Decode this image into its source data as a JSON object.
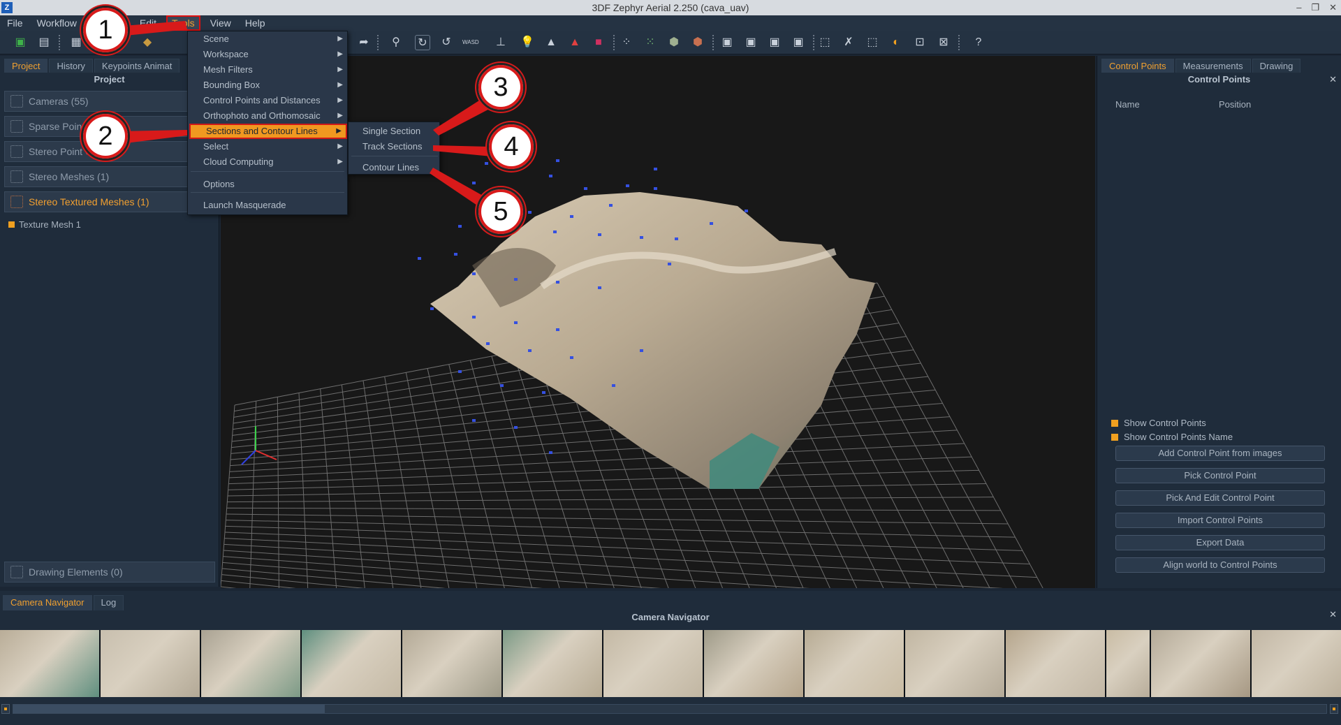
{
  "window": {
    "title": "3DF Zephyr Aerial 2.250 (cava_uav)",
    "icon": "Z",
    "controls": [
      "–",
      "❐",
      "✕"
    ]
  },
  "menubar": [
    "File",
    "Workflow",
    "Edit",
    "Tools",
    "View",
    "Help"
  ],
  "toolbar": {
    "help_label": "?"
  },
  "left_panel": {
    "tabs": [
      "Project",
      "History",
      "Keypoints Animat"
    ],
    "title": "Project",
    "items": [
      "Cameras (55)",
      "Sparse Point",
      "Stereo Point Cl (1)",
      "Stereo Meshes (1)",
      "Stereo Textured Meshes (1)"
    ],
    "tree_item": "Texture Mesh 1",
    "drawing_elements": "Drawing Elements (0)"
  },
  "tools_menu": {
    "items": [
      {
        "label": "Scene",
        "submenu": true
      },
      {
        "label": "Workspace",
        "submenu": true
      },
      {
        "label": "Mesh Filters",
        "submenu": true
      },
      {
        "label": "Bounding Box",
        "submenu": true
      },
      {
        "label": "Control Points and Distances",
        "submenu": true
      },
      {
        "label": "Orthophoto and Orthomosaic",
        "submenu": true
      },
      {
        "label": "Sections and Contour Lines",
        "submenu": true,
        "highlighted": true
      },
      {
        "label": "Select",
        "submenu": true
      },
      {
        "label": "Cloud Computing",
        "submenu": true
      },
      {
        "label": "Options",
        "submenu": false
      },
      {
        "label": "Launch Masquerade",
        "submenu": false
      }
    ]
  },
  "sections_submenu": {
    "items": [
      "Single Section",
      "Track Sections",
      "Contour Lines"
    ]
  },
  "callouts": [
    "1",
    "2",
    "3",
    "4",
    "5"
  ],
  "right_panel": {
    "tabs": [
      "Control Points",
      "Measurements",
      "Drawing"
    ],
    "title": "Control Points",
    "columns": [
      "Name",
      "Position"
    ],
    "close": "✕",
    "checkboxes": [
      "Show Control Points",
      "Show Control Points Name"
    ],
    "buttons": [
      "Add Control Point from images",
      "Pick Control Point",
      "Pick And Edit Control Point",
      "Import Control Points",
      "Export Data",
      "Align world to Control Points"
    ]
  },
  "bottom_panel": {
    "tabs": [
      "Camera Navigator",
      "Log"
    ],
    "title": "Camera Navigator",
    "close": "✕"
  },
  "colors": {
    "accent": "#f0a020",
    "callout_red": "#d81a1a",
    "highlight": "#f09820"
  }
}
